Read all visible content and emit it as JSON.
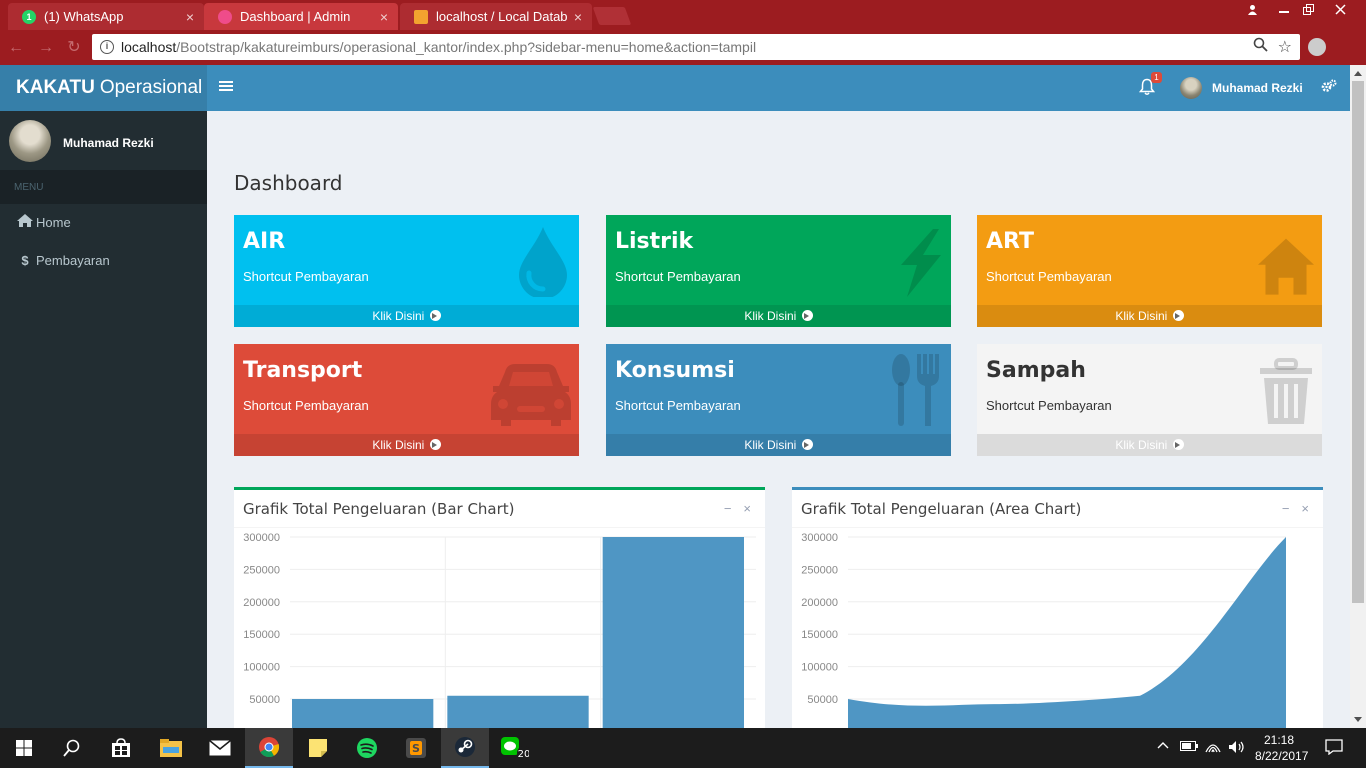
{
  "browser": {
    "tabs": [
      {
        "title": "(1) WhatsApp",
        "active": false
      },
      {
        "title": "Dashboard | Admin",
        "active": true
      },
      {
        "title": "localhost / Local Databa",
        "active": false
      }
    ],
    "url_host": "localhost",
    "url_path": "/Bootstrap/kakatureimburs/operasional_kantor/index.php?sidebar-menu=home&action=tampil",
    "tab_close_glyph": "×"
  },
  "app": {
    "logo_bold": "KAKATU",
    "logo_rest": "Operasional",
    "notification_count": "1",
    "user_name": "Muhamad Rezki"
  },
  "sidebar": {
    "user_name": "Muhamad Rezki",
    "header": "MENU",
    "items": [
      {
        "label": "Home",
        "icon": "home-icon"
      },
      {
        "label": "Pembayaran",
        "icon": "dollar-icon"
      }
    ]
  },
  "page": {
    "title": "Dashboard"
  },
  "boxes": [
    {
      "title": "AIR",
      "subtitle": "Shortcut Pembayaran",
      "footer": "Klik Disini",
      "color": "#00c0ef",
      "footer_color": "#00acd6",
      "icon": "tint-icon"
    },
    {
      "title": "Listrik",
      "subtitle": "Shortcut Pembayaran",
      "footer": "Klik Disini",
      "color": "#00a65a",
      "footer_color": "#009551",
      "icon": "bolt-icon"
    },
    {
      "title": "ART",
      "subtitle": "Shortcut Pembayaran",
      "footer": "Klik Disini",
      "color": "#f39c12",
      "footer_color": "#da8c10",
      "icon": "home-icon"
    },
    {
      "title": "Transport",
      "subtitle": "Shortcut Pembayaran",
      "footer": "Klik Disini",
      "color": "#dd4b39",
      "footer_color": "#c64333",
      "icon": "car-icon"
    },
    {
      "title": "Konsumsi",
      "subtitle": "Shortcut Pembayaran",
      "footer": "Klik Disini",
      "color": "#3c8dbc",
      "footer_color": "#357ea9",
      "icon": "cutlery-icon"
    },
    {
      "title": "Sampah",
      "subtitle": "Shortcut Pembayaran",
      "footer": "Klik Disini",
      "color": "#f4f4f4",
      "footer_color": "#dbdbdb",
      "icon": "trash-icon"
    }
  ],
  "panels": [
    {
      "title": "Grafik Total Pengeluaran (Bar Chart)",
      "accent": "#00a65a"
    },
    {
      "title": "Grafik Total Pengeluaran (Area Chart)",
      "accent": "#3c8dbc"
    }
  ],
  "panel_tools": {
    "minimize": "−",
    "close": "×"
  },
  "chart_data": [
    {
      "type": "bar",
      "categories": [
        "",
        "",
        ""
      ],
      "values": [
        50000,
        55000,
        300000
      ],
      "y_ticks": [
        50000,
        100000,
        150000,
        200000,
        250000,
        300000
      ],
      "ylim": [
        0,
        300000
      ],
      "color": "#4f96c4",
      "grid": true
    },
    {
      "type": "area",
      "values": [
        50000,
        42000,
        55000,
        300000
      ],
      "y_ticks": [
        50000,
        100000,
        150000,
        200000,
        250000,
        300000
      ],
      "ylim": [
        0,
        300000
      ],
      "color": "#4f96c4",
      "grid": true
    }
  ],
  "taskbar": {
    "time": "21:18",
    "date": "8/22/2017",
    "line_badge": "20"
  }
}
